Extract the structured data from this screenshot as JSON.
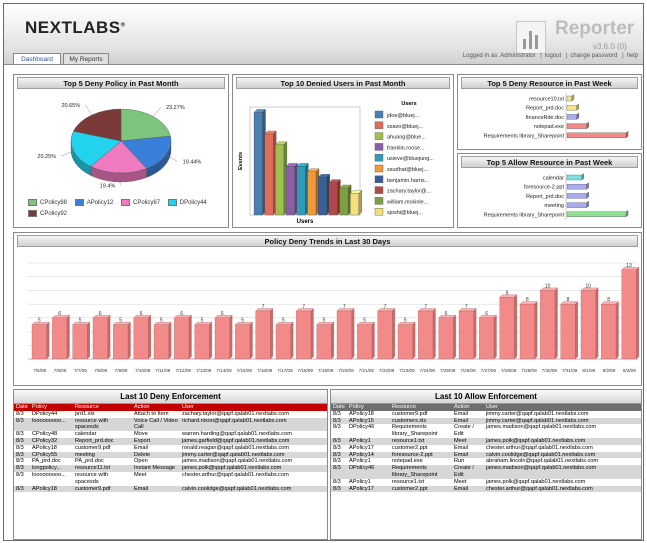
{
  "header": {
    "logo": "NEXTLABS",
    "logo_mark": "®",
    "app_title": "Reporter",
    "version": "v3.6.0 (0)",
    "logged_in": "Logged in as: Administrator",
    "links": [
      "logout",
      "change password",
      "help"
    ]
  },
  "tabs": [
    {
      "label": "Dashboard",
      "active": true
    },
    {
      "label": "My Reports",
      "active": false
    }
  ],
  "colors": {
    "red_header": "#c00000",
    "gray_header": "#6e6e6e",
    "bar_pink": "#f38a8a"
  },
  "pie_panel": {
    "title": "Top 5 Deny Policy in Past Month",
    "legend": [
      {
        "label": "CPolicy88",
        "color": "#7dc47d"
      },
      {
        "label": "APolicy12",
        "color": "#3a7fd9"
      },
      {
        "label": "CPolicy87",
        "color": "#f07ac0"
      },
      {
        "label": "DPolicy44",
        "color": "#22d3ee"
      },
      {
        "label": "CPolicy92",
        "color": "#7b3a3a"
      }
    ]
  },
  "denied_users": {
    "title": "Top 10 Denied Users in Past Month",
    "legend_title": "Users",
    "ylabel": "Events",
    "xlabel": "Users",
    "users": [
      "jdoe@bluej...",
      "ssavo@bluej...",
      "ahuang@blue...",
      "franklin.roose...",
      "usieve@bluejung...",
      "ssudhat@bluej...",
      "benjamin.harris...",
      "zachary.taylor@...",
      "william.mckinle...",
      "sjoshi@bluej..."
    ]
  },
  "deny_resource": {
    "title": "Top 5 Deny Resource in Past Week",
    "items": [
      "resource10.txt",
      "Report_prd.doc",
      "financeRde.doc",
      "notepad.exe",
      "Requirements library_Sharepoint"
    ]
  },
  "allow_resource": {
    "title": "Top 5 Allow Resource in Past Week",
    "items": [
      "calendar",
      "foresource-2.ppt",
      "Report_prd.doc",
      "meeting",
      "Requirements library_Sharepoint"
    ]
  },
  "chart_data": [
    {
      "type": "pie",
      "title": "Top 5 Deny Policy in Past Month",
      "categories": [
        "CPolicy88",
        "APolicy12",
        "CPolicy87",
        "DPolicy44",
        "CPolicy92"
      ],
      "values": [
        23.27,
        19.44,
        19.4,
        20.25,
        20.65
      ],
      "data_labels": [
        "23.27%",
        "19.44%",
        "19.4%",
        "20.25%",
        "20.65%"
      ]
    },
    {
      "type": "bar",
      "title": "Top 10 Denied Users in Past Month",
      "categories": [
        "jdoe@bluej...",
        "ssavo@bluej...",
        "ahuang@blue...",
        "franklin.roose...",
        "usieve@bluejung...",
        "ssudhat@bluej...",
        "benjamin.harris...",
        "zachary.taylor@...",
        "william.mckinle...",
        "sjoshi@bluej..."
      ],
      "values": [
        19,
        15,
        13,
        9,
        9,
        8,
        7,
        6,
        5,
        4
      ],
      "colors": [
        "#4a7fb0",
        "#e06c5c",
        "#9fbf50",
        "#8a5fa7",
        "#2e9bb8",
        "#f09a3a",
        "#3a5f95",
        "#b04a4a",
        "#7fa040",
        "#f4e07a"
      ],
      "xlabel": "Users",
      "ylabel": "Events"
    },
    {
      "type": "bar",
      "title": "Top 5 Deny Resource in Past Week",
      "categories": [
        "resource10.txt",
        "Report_prd.doc",
        "financeRde.doc",
        "notepad.exe",
        "Requirements library_Sharepoint"
      ],
      "values": [
        1,
        2,
        2,
        4,
        12
      ],
      "colors": [
        "#f3e48a",
        "#f3e48a",
        "#a9a9f0",
        "#f38a8a",
        "#f38a8a"
      ]
    },
    {
      "type": "bar",
      "title": "Top 5 Allow Resource in Past Week",
      "categories": [
        "calendar",
        "foresource-2.ppt",
        "Report_prd.doc",
        "meeting",
        "Requirements library_Sharepoint"
      ],
      "values": [
        3,
        4,
        4,
        4,
        12
      ],
      "colors": [
        "#7fe0e0",
        "#a9a9f0",
        "#a9a9f0",
        "#a9a9f0",
        "#8fe08f"
      ]
    },
    {
      "type": "bar",
      "title": "Policy Deny Trends in Last 30 Days",
      "categories": [
        "7/5/09",
        "7/6/09",
        "7/7/09",
        "7/8/09",
        "7/9/09",
        "7/10/09",
        "7/11/09",
        "7/12/09",
        "7/13/09",
        "7/14/09",
        "7/15/09",
        "7/16/09",
        "7/17/09",
        "7/18/09",
        "7/19/09",
        "7/20/09",
        "7/21/09",
        "7/22/09",
        "7/23/09",
        "7/24/09",
        "7/25/09",
        "7/26/09",
        "7/27/09",
        "7/28/09",
        "7/29/09",
        "7/30/09",
        "7/31/09",
        "8/1/09",
        "8/2/09",
        "8/3/09"
      ],
      "values": [
        5,
        6,
        5,
        6,
        5,
        6,
        5,
        6,
        5,
        6,
        5,
        7,
        5,
        7,
        5,
        7,
        5,
        7,
        5,
        7,
        6,
        7,
        6,
        9,
        8,
        10,
        8,
        10,
        8,
        13
      ],
      "ylim": [
        0,
        14
      ]
    }
  ],
  "deny_table": {
    "title": "Last 10 Deny Enforcement",
    "columns": [
      "Date",
      "Policy",
      "Resource",
      "Action",
      "User"
    ],
    "rows": [
      [
        "8/3",
        "DPolicy44",
        "prd1.xls",
        "Attach to Item",
        "zachary.taylor@qapf.qalab01.nextlabs.com"
      ],
      [
        "8/3",
        "looooooooo...",
        "resource with spacesds",
        "Voice Call / Video Call",
        "richard.nixon@qapf.qalab01.nextlabs.com"
      ],
      [
        "8/3",
        "CPolicy48",
        "calendar",
        "Move",
        "warren.harding@qapf.qalab01.nextlabs.com"
      ],
      [
        "8/3",
        "CPolicy32",
        "Report_prd.doc",
        "Export",
        "james.garfield@qapf.qalab01.nextlabs.com"
      ],
      [
        "8/3",
        "APolicy18",
        "customer9.pdf",
        "Email",
        "ronald.reagan@qapf.qalab01.nextlabs.com"
      ],
      [
        "8/3",
        "CPolicy55",
        "meeting",
        "Delete",
        "jimmy.carter@qapf.qalab01.nextlabs.com"
      ],
      [
        "8/3",
        "PA_prd.doc",
        "PA_prd.doc",
        "Open",
        "james.madison@qapf.qalab01.nextlabs.com"
      ],
      [
        "8/3",
        "longpolicy...",
        "resource11.txt",
        "Instant Message",
        "james.polk@qapf.qalab01.nextlabs.com"
      ],
      [
        "8/3",
        "looooooooo...",
        "resource with spacesds",
        "Meet",
        "chester.arthur@qapf.qalab01.nextlabs.com"
      ],
      [
        "8/3",
        "APolicy18",
        "customer9.pdf",
        "Email",
        "calvin.coolidge@qapf.qalab01.nextlabs.com"
      ]
    ]
  },
  "allow_table": {
    "title": "Last 10 Allow Enforcement",
    "columns": [
      "Date",
      "Policy",
      "Resource",
      "Action",
      "User"
    ],
    "rows": [
      [
        "8/3",
        "APolicy18",
        "customer9.pdf",
        "Email",
        "jimmy.carter@qapf.qalab01.nextlabs.com"
      ],
      [
        "8/3",
        "APolicy15",
        "customers.xls",
        "Email",
        "jimmy.carter@qapf.qalab01.nextlabs.com"
      ],
      [
        "8/3",
        "DPolicy46",
        "Requirements library_Sharepoint",
        "Create / Edit",
        "james.madison@qapf.qalab01.nextlabs.com"
      ],
      [
        "8/3",
        "APolicy1",
        "resource1.txt",
        "Meet",
        "james.polk@qapf.qalab01.nextlabs.com"
      ],
      [
        "8/3",
        "APolicy17",
        "customer2.ppt",
        "Email",
        "chester.arthur@qapf.qalab01.nextlabs.com"
      ],
      [
        "8/3",
        "APolicy14",
        "foresource-2.ppt",
        "Email",
        "calvin.coolidge@qapf.qalab01.nextlabs.com"
      ],
      [
        "8/3",
        "APolicy1",
        "notepad.exe",
        "Run",
        "abraham.lincoln@qapf.qalab01.nextlabs.com"
      ],
      [
        "8/3",
        "DPolicy46",
        "Requirements library_Sharepoint",
        "Create / Edit",
        "james.madison@qapf.qalab01.nextlabs.com"
      ],
      [
        "8/3",
        "APolicy1",
        "resource1.txt",
        "Meet",
        "james.polk@qapf.qalab01.nextlabs.com"
      ],
      [
        "8/3",
        "APolicy17",
        "customer2.ppt",
        "Email",
        "chester.arthur@qapf.qalab01.nextlabs.com"
      ]
    ]
  }
}
